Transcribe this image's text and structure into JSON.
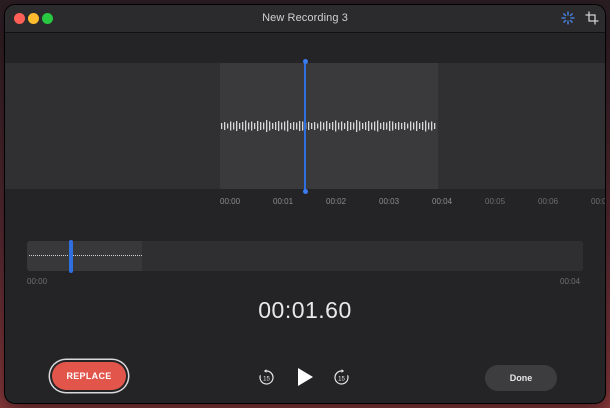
{
  "window": {
    "title": "New Recording 3"
  },
  "toolbar": {
    "enhance_icon": "enhance-recording-icon",
    "trim_icon": "trim-icon"
  },
  "timeline": {
    "ticks": [
      "00:00",
      "00:01",
      "00:02",
      "00:03",
      "00:04",
      "00:05",
      "00:06",
      "00:0"
    ],
    "active_ticks": 5
  },
  "overview": {
    "start_label": "00:00",
    "end_label": "00:04"
  },
  "playback": {
    "current_time": "00:01.60",
    "skip_back_label": "15",
    "skip_forward_label": "15"
  },
  "buttons": {
    "replace_label": "REPLACE",
    "done_label": "Done"
  },
  "colors": {
    "accent": "#2f6fe0",
    "replace": "#e2554a",
    "window_bg": "#242426"
  }
}
